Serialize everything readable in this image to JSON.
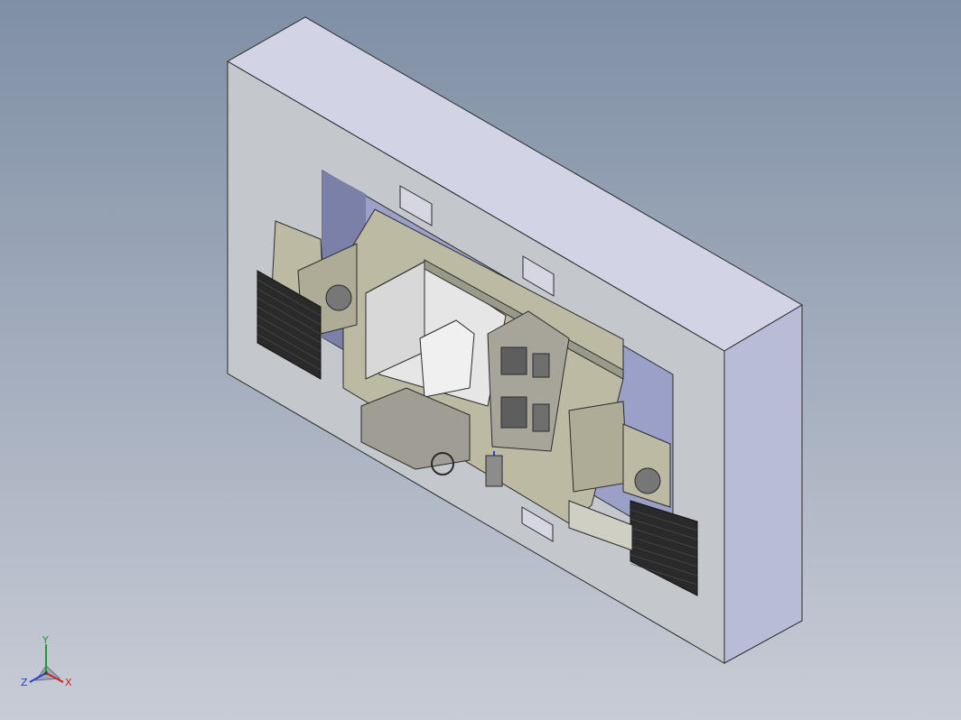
{
  "viewport": {
    "background_top": "#7f8fa5",
    "background_bottom": "#c8ccd6"
  },
  "model": {
    "block_front_color": "#c4c7cc",
    "block_side_color": "#b9bcd6",
    "block_top_color": "#d2d4e6",
    "part_color": "#bdbaa3",
    "grille_color": "#2a2a2a",
    "edge_color": "#2b2b2b"
  },
  "triad": {
    "x_label": "X",
    "y_label": "Y",
    "z_label": "Z",
    "x_color": "#d42020",
    "y_color": "#1f9d2a",
    "z_color": "#2a3fd0"
  }
}
